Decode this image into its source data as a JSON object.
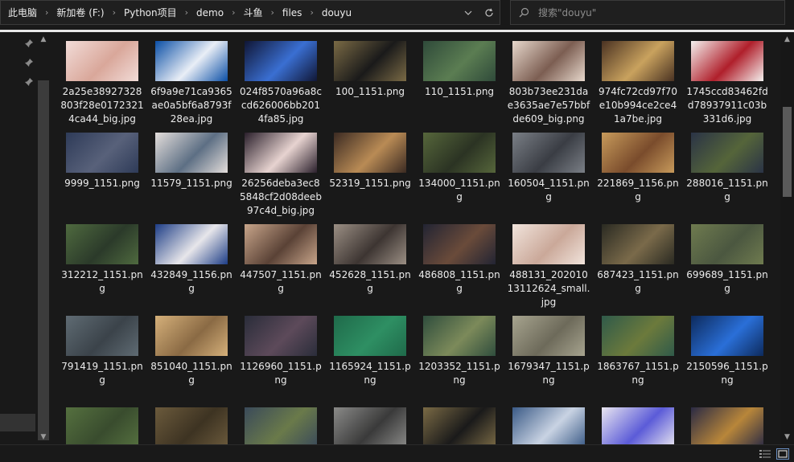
{
  "breadcrumb": [
    "此电脑",
    "新加卷 (F:)",
    "Python项目",
    "demo",
    "斗鱼",
    "files",
    "douyu"
  ],
  "search": {
    "placeholder": "搜索\"douyu\""
  },
  "icons": {
    "breadcrumb_separator": "chevron-right-icon",
    "history_dropdown": "chevron-down-icon",
    "refresh": "refresh-icon",
    "search": "search-icon",
    "pin": "pin-icon",
    "details_view": "details-view-icon",
    "large_icons_view": "large-icons-view-icon"
  },
  "colors": {
    "background": "#191919",
    "text": "#ececec",
    "scrollbar_thumb": "#5a5a5a"
  },
  "files": [
    {
      "name": "2a25e38927328803f28e01723214ca44_big.jpg",
      "colors": [
        "#f2dcd8",
        "#d9a79a"
      ]
    },
    {
      "name": "6f9a9e71ca9365ae0a5bf6a8793f28ea.jpg",
      "colors": [
        "#0b4fa6",
        "#e9eef6"
      ]
    },
    {
      "name": "024f8570a96a8ccd626006bb2014fa85.jpg",
      "colors": [
        "#101635",
        "#3a6fd2"
      ]
    },
    {
      "name": "100_1151.png",
      "colors": [
        "#7a6a45",
        "#1a1a1a"
      ]
    },
    {
      "name": "110_1151.png",
      "colors": [
        "#2f4a3a",
        "#5b7d52"
      ]
    },
    {
      "name": "803b73ee231dae3635ae7e57bbfde609_big.png",
      "colors": [
        "#e7d8cc",
        "#7c5e52"
      ]
    },
    {
      "name": "974fc72cd97f70e10b994ce2ce41a7be.jpg",
      "colors": [
        "#4a3222",
        "#c9a25e"
      ]
    },
    {
      "name": "1745ccd83462fdd78937911c03b331d6.jpg",
      "colors": [
        "#f4f1ef",
        "#b01f2b"
      ]
    },
    {
      "name": "9999_1151.png",
      "colors": [
        "#2e3b58",
        "#58617a"
      ]
    },
    {
      "name": "11579_1151.png",
      "colors": [
        "#e4dedb",
        "#5d6f84"
      ]
    },
    {
      "name": "26256deba3ec85848cf2d08deeb97c4d_big.jpg",
      "colors": [
        "#2a1f2b",
        "#e7d3d0"
      ]
    },
    {
      "name": "52319_1151.png",
      "colors": [
        "#3b2a22",
        "#b98b55"
      ]
    },
    {
      "name": "134000_1151.png",
      "colors": [
        "#56663b",
        "#2b3323"
      ]
    },
    {
      "name": "160504_1151.png",
      "colors": [
        "#7a7f86",
        "#3a3d44"
      ]
    },
    {
      "name": "221869_1156.png",
      "colors": [
        "#c79a5b",
        "#7a4c2c"
      ]
    },
    {
      "name": "288016_1151.png",
      "colors": [
        "#2a3346",
        "#55653a"
      ]
    },
    {
      "name": "312212_1151.png",
      "colors": [
        "#4f6a3f",
        "#2b3a2a"
      ]
    },
    {
      "name": "432849_1156.png",
      "colors": [
        "#1d3d86",
        "#e7e6ea"
      ]
    },
    {
      "name": "447507_1151.png",
      "colors": [
        "#c8a58a",
        "#5a4236"
      ]
    },
    {
      "name": "452628_1151.png",
      "colors": [
        "#9b8f84",
        "#3d3532"
      ]
    },
    {
      "name": "486808_1151.png",
      "colors": [
        "#222433",
        "#6a4b3a"
      ]
    },
    {
      "name": "488131_20201013112624_small.jpg",
      "colors": [
        "#f1e4dc",
        "#caa899"
      ]
    },
    {
      "name": "687423_1151.png",
      "colors": [
        "#2a2a22",
        "#7a6a4a"
      ]
    },
    {
      "name": "699689_1151.png",
      "colors": [
        "#6f7b4f",
        "#4b5740"
      ]
    },
    {
      "name": "791419_1151.png",
      "colors": [
        "#5f6b73",
        "#3b434a"
      ]
    },
    {
      "name": "851040_1151.png",
      "colors": [
        "#d5b07a",
        "#8a6a44"
      ]
    },
    {
      "name": "1126960_1151.png",
      "colors": [
        "#2a2d3a",
        "#5d4a5a"
      ]
    },
    {
      "name": "1165924_1151.png",
      "colors": [
        "#1f6a4a",
        "#2e8f63"
      ]
    },
    {
      "name": "1203352_1151.png",
      "colors": [
        "#2f4d3d",
        "#7c8a5a"
      ]
    },
    {
      "name": "1679347_1151.png",
      "colors": [
        "#a7a48f",
        "#6d6a5a"
      ]
    },
    {
      "name": "1863767_1151.png",
      "colors": [
        "#2f5a4a",
        "#6c7a3c"
      ]
    },
    {
      "name": "2150596_1151.png",
      "colors": [
        "#0d2a5c",
        "#2a6fd8"
      ]
    },
    {
      "colors": [
        "#55703f",
        "#394c2e"
      ]
    },
    {
      "colors": [
        "#6b5a3c",
        "#3d3322"
      ]
    },
    {
      "colors": [
        "#3a4a5a",
        "#6a7a4a"
      ]
    },
    {
      "colors": [
        "#8a8a88",
        "#3a3a3a"
      ]
    },
    {
      "colors": [
        "#7a6a45",
        "#1a1a1a"
      ]
    },
    {
      "colors": [
        "#3a5a86",
        "#c9d3e3"
      ]
    },
    {
      "colors": [
        "#e9e6f0",
        "#5b5bd8"
      ]
    },
    {
      "colors": [
        "#2a2a44",
        "#b8863a"
      ]
    }
  ]
}
